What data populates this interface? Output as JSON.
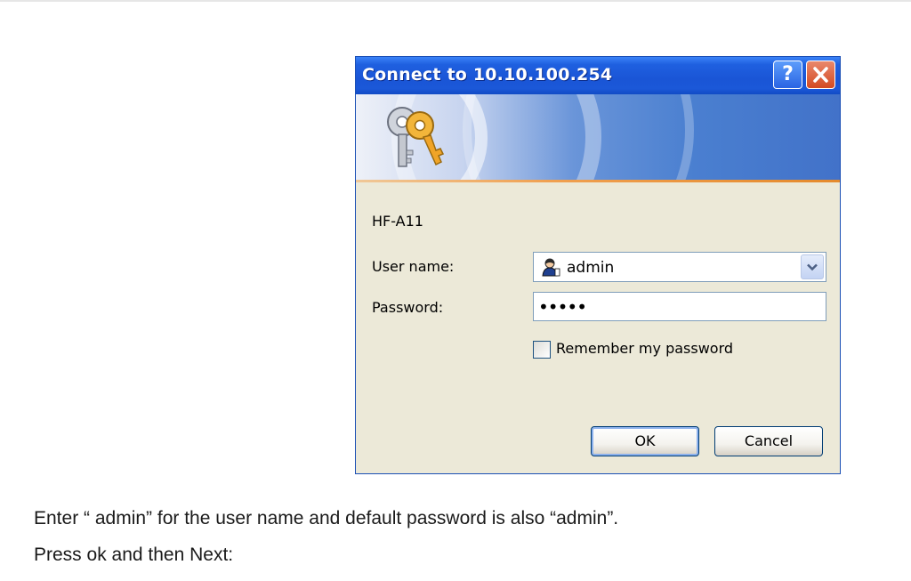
{
  "dialog": {
    "title": "Connect to 10.10.100.254",
    "help_icon": "?",
    "close_icon": "X",
    "realm": "HF-A11",
    "username_label": "User name:",
    "username_value": "admin",
    "password_label": "Password:",
    "password_value": "•••••",
    "remember_label": "Remember my password",
    "remember_checked": false,
    "ok_label": "OK",
    "cancel_label": "Cancel",
    "icons": [
      "keys-icon",
      "user-icon",
      "chevron-down-icon",
      "help-icon",
      "close-icon"
    ],
    "colors": {
      "titlebar": "#1a55d6",
      "dialog_body": "#ece9d8",
      "close_button": "#d34a22"
    }
  },
  "instructions": {
    "line1": "Enter “ admin” for the user name and default password is also “admin”.",
    "line2": "Press ok and then Next:"
  }
}
